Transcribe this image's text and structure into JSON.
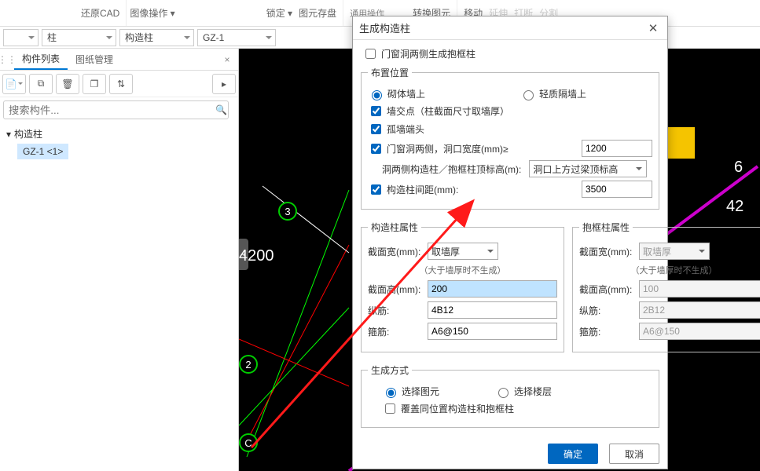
{
  "top_toolbar": {
    "restore_cad_label": "还原CAD",
    "image_ops_label": "图像操作 ▾",
    "lock_label": "锁定 ▾",
    "layer_label": "图元存盘",
    "common_ops_label": "通用操作",
    "convert_layer_label": "转换图元",
    "move_label": "移动",
    "extend_label": "延伸",
    "break_label": "打断",
    "split_label": "分割"
  },
  "dropdowns": {
    "first": "",
    "col": "柱",
    "gz_col": "构造柱",
    "gz1": "GZ-1"
  },
  "left": {
    "tab_components": "构件列表",
    "tab_drawings": "图纸管理",
    "search_placeholder": "搜索构件...",
    "tree_root": "构造柱",
    "tree_item": "GZ-1  <1>"
  },
  "canvas": {
    "dim_4200": "4200",
    "node_3": "3",
    "node_2": "2",
    "node_C": "C",
    "dim_6_right": "6",
    "dim_42_right": "42"
  },
  "dialog": {
    "title": "生成构造柱",
    "chk_opening_both": "门窗洞两侧生成抱框柱",
    "group_placement": "布置位置",
    "rb_masonry": "砌体墙上",
    "rb_light": "轻质隔墙上",
    "chk_intersection": "墙交点（柱截面尺寸取墙厚）",
    "chk_wall_end": "孤墙端头",
    "chk_opening_rule": "门窗洞两侧，洞口宽度(mm)≥",
    "opening_width_value": "1200",
    "top_elev_label": "洞两侧构造柱／抱框柱顶标高(m):",
    "top_elev_select": "洞口上方过梁顶标高",
    "chk_spacing": "构造柱间距(mm):",
    "spacing_value": "3500",
    "group_gz_props": "构造柱属性",
    "group_bk_props": "抱框柱属性",
    "prop_width_label": "截面宽(mm):",
    "prop_width_gz_sel": "取墙厚",
    "prop_width_bk_sel": "取墙厚",
    "hint_both": "（大于墙厚时不生成）",
    "prop_height_label": "截面高(mm):",
    "gz_height_value": "200",
    "bk_height_value": "100",
    "vert_bar_label": "纵筋:",
    "gz_vert_value": "4B12",
    "bk_vert_value": "2B12",
    "stirrup_label": "箍筋:",
    "gz_stirrup_value": "A6@150",
    "bk_stirrup_value": "A6@150",
    "group_gen_mode": "生成方式",
    "rb_sel_elem": "选择图元",
    "rb_sel_floor": "选择楼层",
    "chk_overwrite": "覆盖同位置构造柱和抱框柱",
    "btn_ok": "确定",
    "btn_cancel": "取消"
  }
}
